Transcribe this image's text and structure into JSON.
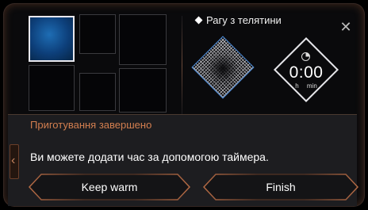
{
  "recipe": {
    "title": "Рагу з телятини"
  },
  "timer": {
    "value": "0:00",
    "unit_hours": "h",
    "unit_minutes": "min"
  },
  "panel": {
    "title": "Приготування завершено",
    "message": "Ви можете додати час за допомогою таймера."
  },
  "buttons": {
    "keep_warm": "Keep warm",
    "finish": "Finish"
  },
  "colors": {
    "accent": "#d27e4f",
    "active_zone": "#1e6db4",
    "frame": "#6b3f2a"
  },
  "icons": {
    "close": "close-icon",
    "timer": "timer-icon",
    "bullet": "diamond-bullet-icon",
    "back": "chevron-left-icon"
  }
}
